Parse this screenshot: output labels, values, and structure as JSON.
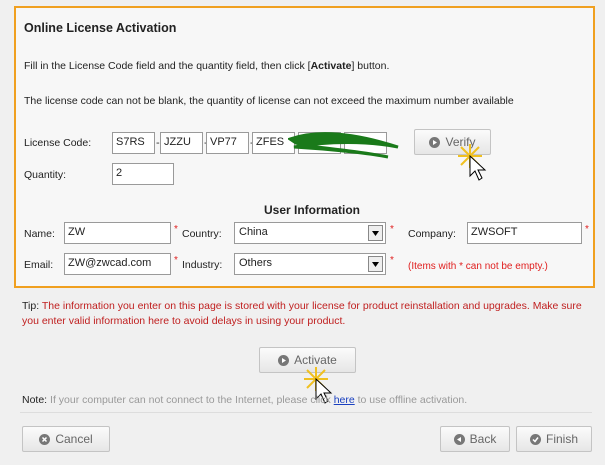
{
  "panel": {
    "title": "Online License Activation",
    "instruction_prefix": "Fill in the License Code field and the quantity field, then click [",
    "instruction_bold": "Activate",
    "instruction_suffix": "] button.",
    "instruction2": "The license code can not be blank, the quantity of license can not exceed the maximum number available"
  },
  "license": {
    "label": "License Code:",
    "segments": [
      "S7RS",
      "JZZU",
      "VP77",
      "ZFES",
      "",
      ""
    ],
    "quantity_label": "Quantity:",
    "quantity_value": "2",
    "verify_label": "Verify"
  },
  "user_info": {
    "section_title": "User Information",
    "name_label": "Name:",
    "name_value": "ZW",
    "country_label": "Country:",
    "country_value": "China",
    "company_label": "Company:",
    "company_value": "ZWSOFT",
    "email_label": "Email:",
    "email_value": "ZW@zwcad.com",
    "industry_label": "Industry:",
    "industry_value": "Others",
    "required_marker": "*",
    "required_note": "(Items with * can not be empty.)"
  },
  "tip": {
    "label": "Tip:",
    "text": " The information you enter on this page is stored with your license for product reinstallation and upgrades. Make sure you enter valid information here to avoid delays in using your product."
  },
  "activate_label": "Activate",
  "note": {
    "label": "Note:",
    "text_before": " If your computer can not connect to the Internet, please click ",
    "link": "here",
    "text_after": " to use offline activation."
  },
  "footer": {
    "cancel_label": "Cancel",
    "back_label": "Back",
    "finish_label": "Finish"
  },
  "colors": {
    "panel_border": "#f0a020",
    "required_red": "#e02020",
    "link_blue": "#1a40c0",
    "scribble_green": "#1a7a1a"
  }
}
